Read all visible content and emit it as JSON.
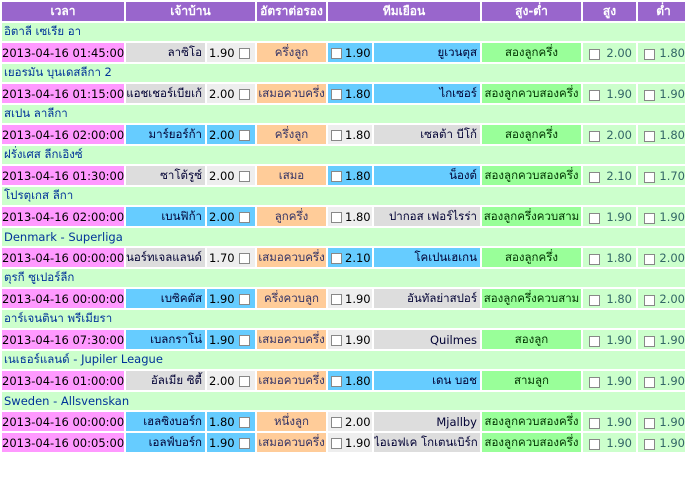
{
  "headers": {
    "time": "เวลา",
    "home": "เจ้าบ้าน",
    "handicap": "อัตราต่อรอง",
    "away": "ทีมเยือน",
    "ou": "สูง-ต่ำ",
    "over": "สูง",
    "under": "ต่ำ"
  },
  "groups": [
    {
      "league": "อิตาลี เซเรีย อา",
      "matches": [
        {
          "time": "2013-04-16 01:45:00",
          "home": "ลาซิโอ",
          "home_odd": "1.90",
          "handicap": "ครึ่งลูก",
          "away_odd": "1.90",
          "away": "ยูเวนตุส",
          "ou": "สองลูกครึ่ง",
          "over": "2.00",
          "under": "1.80",
          "fav": "away",
          "hcap_alt": false
        }
      ]
    },
    {
      "league": "เยอรมัน บุนเดสลีกา 2",
      "matches": [
        {
          "time": "2013-04-16 01:15:00",
          "home": "แอชเชอร์เบียเก้",
          "home_odd": "2.00",
          "handicap": "เสมอควบครึ่ง",
          "away_odd": "1.80",
          "away": "ไกเซอร์",
          "ou": "สองลูกควบสองครึ่ง",
          "over": "1.90",
          "under": "1.90",
          "fav": "away",
          "hcap_alt": false
        }
      ]
    },
    {
      "league": "สเปน ลาลีกา",
      "matches": [
        {
          "time": "2013-04-16 02:00:00",
          "home": "มาร์ยอร์ก้า",
          "home_odd": "2.00",
          "handicap": "ครึ่งลูก",
          "away_odd": "1.80",
          "away": "เซลต้า บีโก้",
          "ou": "สองลูกครึ่ง",
          "over": "2.00",
          "under": "1.80",
          "fav": "home",
          "hcap_alt": false
        }
      ]
    },
    {
      "league": "ฝรั่งเศส ลีกเอิงซ์",
      "matches": [
        {
          "time": "2013-04-16 01:30:00",
          "home": "ซาโต้รูซ์",
          "home_odd": "2.00",
          "handicap": "เสมอ",
          "away_odd": "1.80",
          "away": "น็องต์",
          "ou": "สองลูกควบสองครึ่ง",
          "over": "2.10",
          "under": "1.70",
          "fav": "away",
          "hcap_alt": false
        }
      ]
    },
    {
      "league": "โปรตุเกส ลีกา",
      "matches": [
        {
          "time": "2013-04-16 02:00:00",
          "home": "เบนฟิก้า",
          "home_odd": "2.00",
          "handicap": "ลูกครึ่ง",
          "away_odd": "1.80",
          "away": "ปากอส เฟอร์ไรร่า",
          "ou": "สองลูกครึ่งควบสาม",
          "over": "1.90",
          "under": "1.90",
          "fav": "home",
          "hcap_alt": false
        }
      ]
    },
    {
      "league": "Denmark - Superliga",
      "matches": [
        {
          "time": "2013-04-16 00:00:00",
          "home": "นอร์ทเจลแลนด์",
          "home_odd": "1.70",
          "handicap": "เสมอควบครึ่ง",
          "away_odd": "2.10",
          "away": "โคเปนเฮเกน",
          "ou": "สองลูกครึ่ง",
          "over": "1.80",
          "under": "2.00",
          "fav": "away",
          "hcap_alt": false
        }
      ]
    },
    {
      "league": "ตุรกี ซูเปอร์ลีก",
      "matches": [
        {
          "time": "2013-04-16 00:00:00",
          "home": "เบซิคตัส",
          "home_odd": "1.90",
          "handicap": "ครึ่งควบลูก",
          "away_odd": "1.90",
          "away": "อันทัลย่าสปอร์",
          "ou": "สองลูกครึ่งควบสาม",
          "over": "1.80",
          "under": "2.00",
          "fav": "home",
          "hcap_alt": false
        }
      ]
    },
    {
      "league": "อาร์เจนตินา พรีเมียรา",
      "matches": [
        {
          "time": "2013-04-16 07:30:00",
          "home": "เบลกราโน่",
          "home_odd": "1.90",
          "handicap": "เสมอควบครึ่ง",
          "away_odd": "1.90",
          "away": "Quilmes",
          "ou": "สองลูก",
          "over": "1.90",
          "under": "1.90",
          "fav": "home",
          "hcap_alt": false
        }
      ]
    },
    {
      "league": "เนเธอร์แลนด์ - Jupiler League",
      "matches": [
        {
          "time": "2013-04-16 01:00:00",
          "home": "อัลเมีย ซิตี้",
          "home_odd": "2.00",
          "handicap": "เสมอควบครึ่ง",
          "away_odd": "1.80",
          "away": "เดน บอช",
          "ou": "สามลูก",
          "over": "1.90",
          "under": "1.90",
          "fav": "away",
          "hcap_alt": false
        }
      ]
    },
    {
      "league": "Sweden - Allsvenskan",
      "matches": [
        {
          "time": "2013-04-16 00:00:00",
          "home": "เฮลซิงบอร์ก",
          "home_odd": "1.80",
          "handicap": "หนึ่งลูก",
          "away_odd": "2.00",
          "away": "Mjallby",
          "ou": "สองลูกควบสองครึ่ง",
          "over": "1.90",
          "under": "1.90",
          "fav": "home",
          "hcap_alt": false
        },
        {
          "time": "2013-04-16 00:05:00",
          "home": "เอลฟ์บอร์ก",
          "home_odd": "1.90",
          "handicap": "เสมอควบครึ่ง",
          "away_odd": "1.90",
          "away": "ไอเอฟเค โกเตนเบิร์ก",
          "ou": "สองลูกควบสองครึ่ง",
          "over": "1.90",
          "under": "1.90",
          "fav": "home",
          "hcap_alt": false
        }
      ]
    }
  ],
  "colors": {
    "header": "#9966cc",
    "league_row": "#ccffcc",
    "time_cell": "#ff99ff",
    "favorite_team": "#66ccff",
    "handicap_cell": "#ffcc99",
    "over_under_cell": "#99ff99"
  }
}
